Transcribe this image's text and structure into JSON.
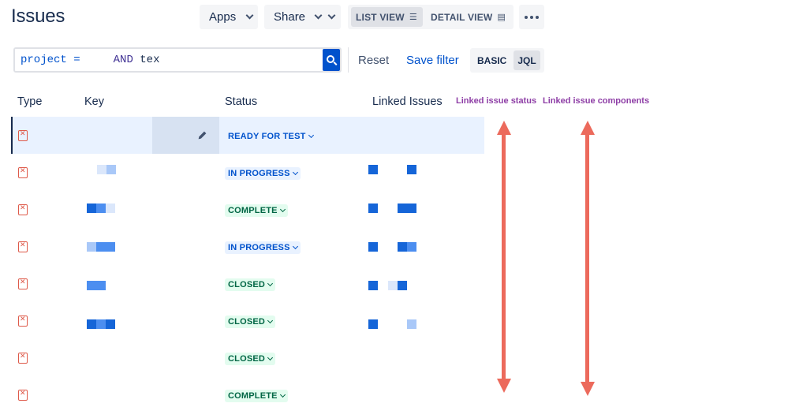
{
  "header": {
    "title": "Issues"
  },
  "toolbar": {
    "apps_label": "Apps",
    "share_label": "Share",
    "list_view_label": "LIST VIEW",
    "detail_view_label": "DETAIL VIEW"
  },
  "search": {
    "jql_kw1": "project =",
    "jql_and": "AND",
    "jql_tail": "tex",
    "reset_label": "Reset",
    "save_filter_label": "Save filter",
    "mode_basic": "BASIC",
    "mode_jql": "JQL"
  },
  "table": {
    "columns": [
      "Type",
      "Key",
      "Status",
      "Linked Issues"
    ],
    "annotations": [
      "Linked issue status",
      "Linked issue components"
    ],
    "rows": [
      {
        "status": "READY FOR TEST",
        "status_kind": "ready",
        "selected": true
      },
      {
        "status": "IN PROGRESS",
        "status_kind": "inprog"
      },
      {
        "status": "COMPLETE",
        "status_kind": "complete"
      },
      {
        "status": "IN PROGRESS",
        "status_kind": "inprog"
      },
      {
        "status": "CLOSED",
        "status_kind": "closed"
      },
      {
        "status": "CLOSED",
        "status_kind": "closed"
      },
      {
        "status": "CLOSED",
        "status_kind": "closed"
      },
      {
        "status": "COMPLETE",
        "status_kind": "complete"
      }
    ]
  },
  "colors": {
    "accent": "#0052cc",
    "annotation": "#8e3ea6",
    "arrow": "#ec6a5c",
    "bug": "#de5a4a"
  }
}
